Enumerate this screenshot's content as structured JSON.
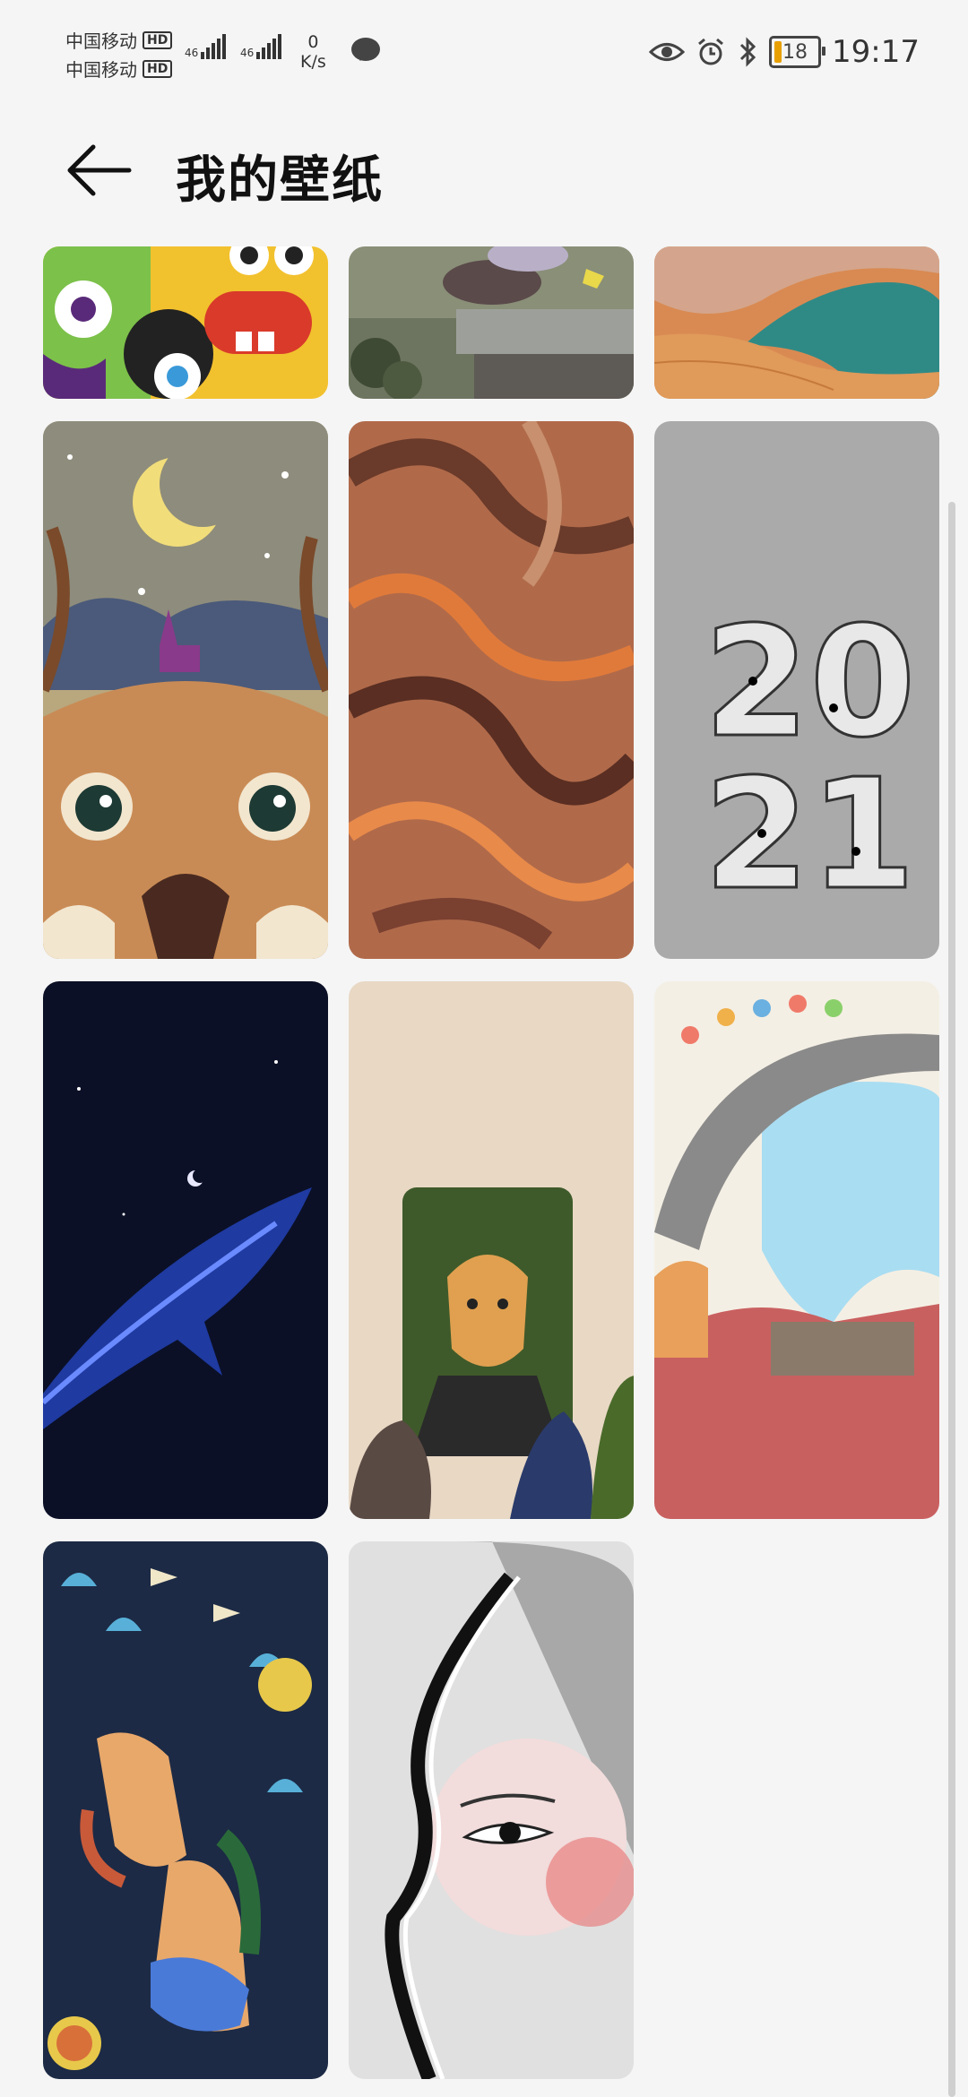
{
  "status": {
    "carrier1": "中国移动",
    "carrier2": "中国移动",
    "hd": "HD",
    "net1": "46",
    "net2": "46",
    "speed_value": "0",
    "speed_unit": "K/s",
    "battery": "18",
    "time": "19:17"
  },
  "header": {
    "title": "我的壁纸"
  },
  "wallpapers": [
    {
      "label": "cartoon-monsters",
      "accent": "#f2c12e"
    },
    {
      "label": "girl-on-roof",
      "accent": "#8a8f78"
    },
    {
      "label": "desert-dunes",
      "accent": "#d98a52"
    },
    {
      "label": "deer-moon",
      "accent": "#b9a77e"
    },
    {
      "label": "marble-swirl",
      "accent": "#b06a4a"
    },
    {
      "label": "2021-numbers",
      "accent": "#aaaaaa"
    },
    {
      "label": "night-whale",
      "accent": "#0b1026"
    },
    {
      "label": "leopard-portrait",
      "accent": "#e8d8c4"
    },
    {
      "label": "cat-town-bridge",
      "accent": "#c96060"
    },
    {
      "label": "folk-art-figures",
      "accent": "#1c2a45"
    },
    {
      "label": "face-profile",
      "accent": "#e0e0e0"
    }
  ]
}
